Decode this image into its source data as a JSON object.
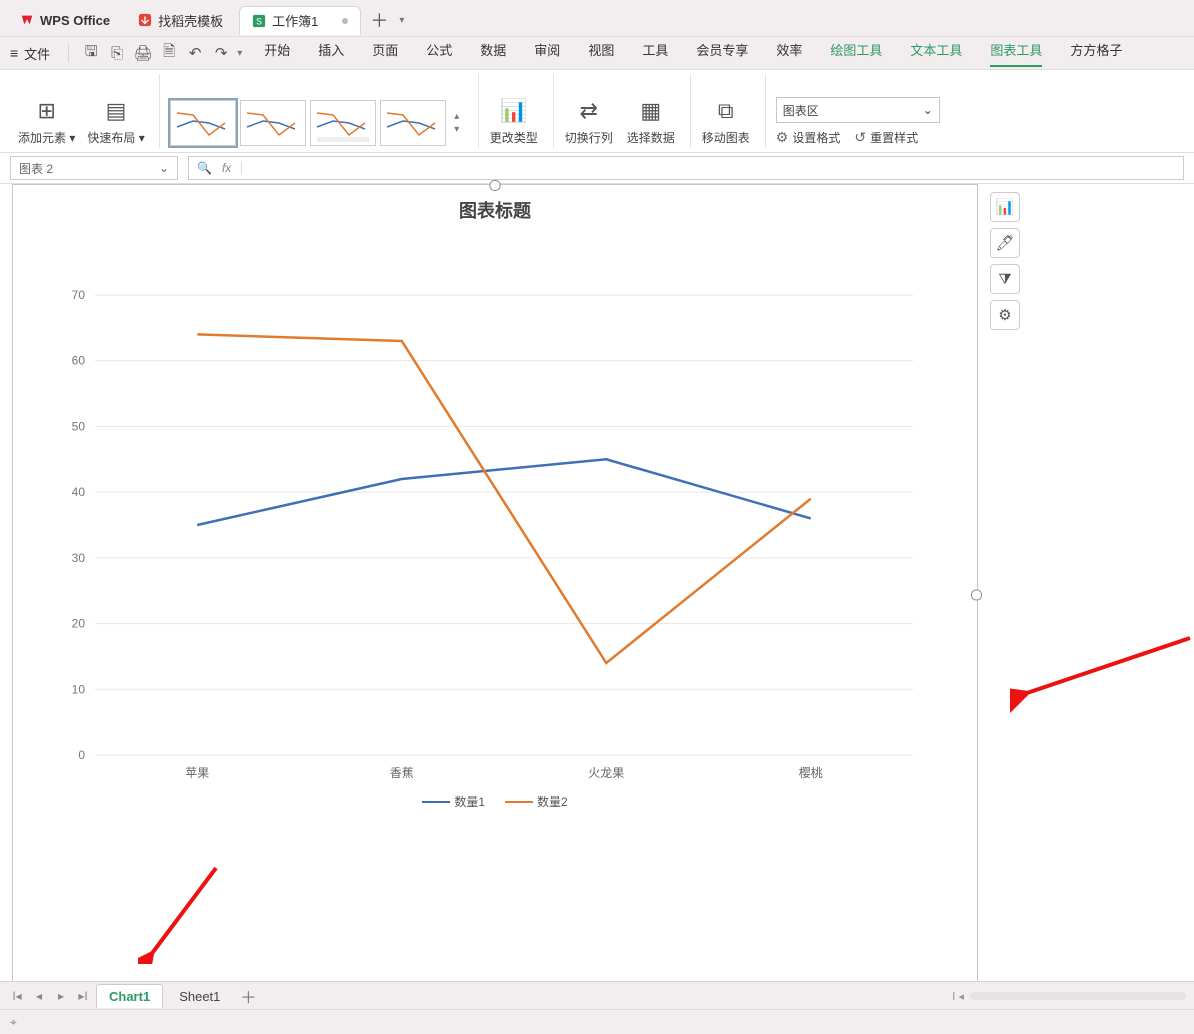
{
  "tabs": {
    "app": "WPS Office",
    "template": "找稻壳模板",
    "workbook": "工作簿1"
  },
  "menubar": {
    "file": "文件",
    "items": [
      "开始",
      "插入",
      "页面",
      "公式",
      "数据",
      "审阅",
      "视图",
      "工具",
      "会员专享",
      "效率",
      "绘图工具",
      "文本工具",
      "图表工具",
      "方方格子"
    ]
  },
  "ribbon": {
    "add_element": "添加元素",
    "quick_layout": "快速布局",
    "change_type": "更改类型",
    "switch_rowcol": "切换行列",
    "select_data": "选择数据",
    "move_chart": "移动图表",
    "area_select": "图表区",
    "set_format": "设置格式",
    "reset_style": "重置样式"
  },
  "namebox": "图表 2",
  "fx_placeholder": "fx",
  "chart_data": {
    "type": "line",
    "title": "图表标题",
    "categories": [
      "苹果",
      "香蕉",
      "火龙果",
      "樱桃"
    ],
    "series": [
      {
        "name": "数量1",
        "color": "#3f6fb5",
        "values": [
          35,
          42,
          45,
          36
        ]
      },
      {
        "name": "数量2",
        "color": "#e07b2e",
        "values": [
          64,
          63,
          14,
          39
        ]
      }
    ],
    "ylim": [
      0,
      70
    ],
    "ytick": 10,
    "xlabel": "",
    "ylabel": ""
  },
  "sheet_tabs": [
    "Chart1",
    "Sheet1"
  ],
  "side_buttons": [
    "chart-element-icon",
    "format-icon",
    "filter-icon",
    "settings-icon"
  ]
}
